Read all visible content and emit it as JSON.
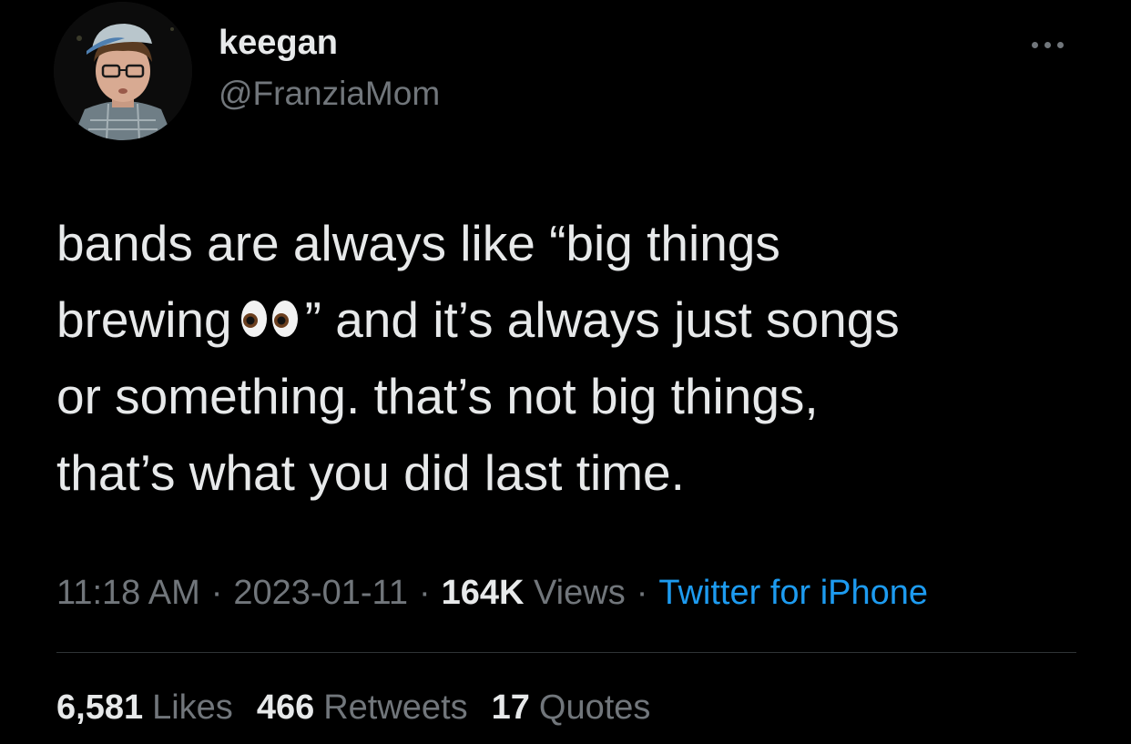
{
  "author": {
    "name": "keegan",
    "handle": "@FranziaMom",
    "avatar_icon": "profile-photo"
  },
  "more_icon": "more-horizontal-icon",
  "tweet": {
    "lines": [
      "bands are always like “big things",
      "brewing",
      "” and it’s always just songs",
      "or something. that’s not big things,",
      "that’s what you did last time."
    ],
    "emoji": "👀"
  },
  "meta": {
    "time": "11:18 AM",
    "date": "2023-01-11",
    "views_count": "164K",
    "views_label": "Views",
    "separator": "·",
    "source": "Twitter for iPhone"
  },
  "stats": {
    "likes_count": "6,581",
    "likes_label": "Likes",
    "retweets_count": "466",
    "retweets_label": "Retweets",
    "quotes_count": "17",
    "quotes_label": "Quotes"
  },
  "colors": {
    "background": "#000000",
    "text_primary": "#e7e9ea",
    "text_secondary": "#71767b",
    "link": "#1d9bf0",
    "divider": "#2f3336"
  }
}
